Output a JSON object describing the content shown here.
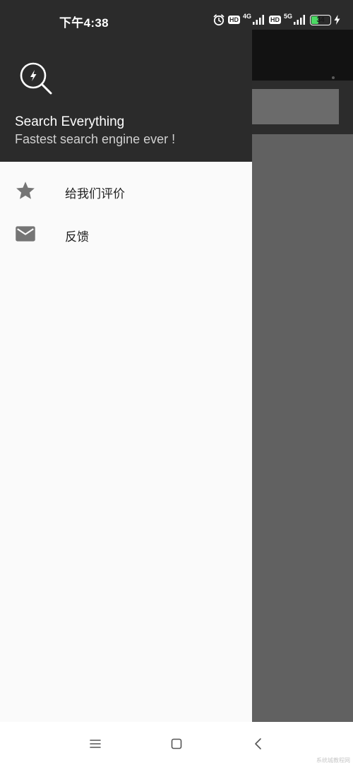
{
  "status_bar": {
    "time": "下午4:38",
    "hd_badge_1": "HD",
    "net_1": "4G",
    "hd_badge_2": "HD",
    "net_2": "5G",
    "battery_level": "34",
    "battery_fraction": 0.34
  },
  "drawer": {
    "app_name": "Search Everything",
    "tagline": "Fastest search engine ever !",
    "items": [
      {
        "label": "给我们评价",
        "icon": "star-icon"
      },
      {
        "label": "反馈",
        "icon": "mail-icon"
      }
    ]
  },
  "nav": {
    "menu_icon": "menu-lines-icon",
    "home_icon": "square-home-icon",
    "back_icon": "chevron-back-icon"
  },
  "watermark": "系统城教程网",
  "colors": {
    "drawer_header": "#2b2b2b",
    "drawer_bg": "#fafafa",
    "scrim": "#616161",
    "icon_gray": "#757575",
    "battery_green": "#4cd964"
  }
}
